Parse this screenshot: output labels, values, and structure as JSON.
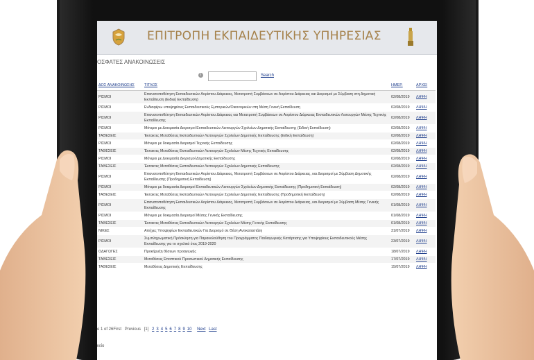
{
  "site": {
    "title": "ΕΠΙΤΡΟΠΗ ΕΚΠΑΙΔΕΥΤΙΚΗΣ ΥΠΗΡΕΣΙΑΣ"
  },
  "section_title": "ΟΣΦΑΤΕΣ ΑΝΑΚΟΙΝΩΣΕΙΣ",
  "search": {
    "placeholder": "",
    "button_label": "Search"
  },
  "table": {
    "headers": [
      "ΔΟΣ ΑΝΑΚΟΙΝΩΣΗΣ",
      "ΤΙΤΛΟΣ",
      "ΗΜΕΡ.",
      "ΑΡΧΕΙ"
    ],
    "rows": [
      {
        "cat": "ΡΙΣΜΟΙ",
        "title": "Επανατοποθέτηση Εκπαιδευτικών Αορίστου Διάρκειας, Μετατροπή Συμβάσεων σε Αορίστου Διάρκειας και Διορισμοί με Σύμβαση στη Δημοτική Εκπαίδευση (Ειδική Εκπαίδευση)",
        "date": "02/08/2019",
        "action": "ΛΗΨΗ"
      },
      {
        "cat": "ΡΙΣΜΟΙ",
        "title": "Ενδιαφέρω υποψηφίους Εκπαιδευτικούς Εμπορικών/Οικονομικών στη Μέση Γενική Εκπαίδευση",
        "date": "02/08/2019",
        "action": "ΛΗΨΗ"
      },
      {
        "cat": "ΡΙΣΜΟΙ",
        "title": "Επανατοποθέτηση Εκπαιδευτικών Αορίστου Διάρκειας και Μετατροπή Συμβάσεων σε Αορίστου Διάρκειας Εκπαιδευτικών Λειτουργών Μέσης Τεχνικής Εκπαίδευσης",
        "date": "02/08/2019",
        "action": "ΛΗΨΗ"
      },
      {
        "cat": "ΡΙΣΜΟΙ",
        "title": "Μόνιμοι με Δοκιμασία Διορισμοί Εκπαιδευτικών Λειτουργών Σχολείων Δημοτικής Εκπαίδευσης (Ειδική Εκπαίδευση)",
        "date": "02/08/2019",
        "action": "ΛΗΨΗ"
      },
      {
        "cat": "ΤΑΘΕΣΕΙΣ",
        "title": "Έκτακτες Μεταθέσεις Εκπαιδευτικών Λειτουργών Σχολείων Δημοτικής Εκπαίδευσης (Ειδική Εκπαίδευση)",
        "date": "02/08/2019",
        "action": "ΛΗΨΗ"
      },
      {
        "cat": "ΡΙΣΜΟΙ",
        "title": "Μόνιμοι με δοκιμασία Διορισμοί Τεχνικής Εκπαίδευσης",
        "date": "02/08/2019",
        "action": "ΛΗΨΗ"
      },
      {
        "cat": "ΤΑΘΕΣΕΙΣ",
        "title": "Έκτακτες Μεταθέσεις Εκπαιδευτικών Λειτουργών Σχολείων Μέσης Τεχνικής Εκπαίδευσης",
        "date": "02/08/2019",
        "action": "ΛΗΨΗ"
      },
      {
        "cat": "ΡΙΣΜΟΙ",
        "title": "Μόνιμοι με Δοκιμασία Διορισμοί Δημοτικής Εκπαίδευσης",
        "date": "02/08/2019",
        "action": "ΛΗΨΗ"
      },
      {
        "cat": "ΤΑΘΕΣΕΙΣ",
        "title": "Έκτακτες Μεταθέσεις Εκπαιδευτικών Λειτουργών Σχολείων Δημοτικής Εκπαίδευσης",
        "date": "02/08/2019",
        "action": "ΛΗΨΗ"
      },
      {
        "cat": "ΡΙΣΜΟΙ",
        "title": "Επανατοποθέτηση Εκπαιδευτικών Αορίστου Διάρκειας, Μετατροπή Συμβάσεων σε Αορίστου Διάρκειας, και Διορισμοί με Σύμβαση Δημοτικής Εκπαίδευσης (Προδημοτική Εκπαίδευση)",
        "date": "02/08/2019",
        "action": "ΛΗΨΗ"
      },
      {
        "cat": "ΡΙΣΜΟΙ",
        "title": "Μόνιμοι με δοκιμασία Διορισμοί Εκπαιδευτικών Λειτουργών Σχολείων Δημοτικής Εκπαίδευσης (Προδημοτική Εκπαίδευση)",
        "date": "02/08/2019",
        "action": "ΛΗΨΗ"
      },
      {
        "cat": "ΤΑΘΕΣΕΙΣ",
        "title": "Έκτακτες Μεταθέσεις Εκπαιδευτικών Λειτουργών Σχολείων Δημοτικής Εκπαίδευσης (Προδημοτική Εκπαίδευση)",
        "date": "02/08/2019",
        "action": "ΛΗΨΗ"
      },
      {
        "cat": "ΡΙΣΜΟΙ",
        "title": "Επανατοποθέτηση Εκπαιδευτικών Αορίστου Διάρκειας, Μετατροπή Συμβάσεων σε Αορίστου Διάρκειας, και Διορισμοί με Σύμβαση Μέσης Γενικής Εκπαίδευσης",
        "date": "01/08/2019",
        "action": "ΛΗΨΗ"
      },
      {
        "cat": "ΡΙΣΜΟΙ",
        "title": "Μόνιμοι με δοκιμασία Διορισμοί Μέσης Γενικής Εκπαίδευσης",
        "date": "01/08/2019",
        "action": "ΛΗΨΗ"
      },
      {
        "cat": "ΤΑΘΕΣΕΙΣ",
        "title": "Έκτακτες Μεταθέσεις Εκπαιδευτικών Λειτουργών Σχολείων Μέσης Γενικής Εκπαίδευσης",
        "date": "01/08/2019",
        "action": "ΛΗΨΗ"
      },
      {
        "cat": "ΝΙΚΕΣ",
        "title": "Απήχες Υποψηφίων Εκπαιδευτικών Για Διορισμό σε Θέση Αντικαταστάτη",
        "date": "31/07/2019",
        "action": "ΛΗΨΗ"
      },
      {
        "cat": "ΡΙΣΜΟΙ",
        "title": "Συμπληρωματική Πρόσκληση για Παρακολούθηση του Προγράμματος Παιδαγωγικής Κατάρτισης για Υποψηφίους Εκπαιδευτικούς Μέσης Εκπαίδευσης για το σχολικό έτος 2019-2020",
        "date": "23/07/2019",
        "action": "ΛΗΨΗ"
      },
      {
        "cat": "ΟΔΑΓΩΓΕΣ",
        "title": "Προκήρυξη θέσεων προαγωγής",
        "date": "18/07/2019",
        "action": "ΛΗΨΗ"
      },
      {
        "cat": "ΤΑΘΕΣΕΙΣ",
        "title": "Μεταθέσεις Εποπτικού Προσωπικού Δημοτικής Εκπαίδευσης",
        "date": "17/07/2019",
        "action": "ΛΗΨΗ"
      },
      {
        "cat": "ΤΑΘΕΣΕΙΣ",
        "title": "Μεταθέσεις Δημοτικής Εκπαίδευσης",
        "date": "15/07/2019",
        "action": "ΛΗΨΗ"
      }
    ]
  },
  "pager": {
    "summary": "e 1 of 26First",
    "previous": "Previous",
    "current": "[1]",
    "pages": [
      "2",
      "3",
      "4",
      "5",
      "6",
      "7",
      "8",
      "9",
      "10"
    ],
    "next": "Next",
    "last": "Last"
  },
  "footer_text": "κείο",
  "colors": {
    "title_gold": "#a5814a",
    "link_blue": "#1a3a8a",
    "header_bg": "#e6e8ec",
    "tablet_frame": "#1a1a1a"
  }
}
